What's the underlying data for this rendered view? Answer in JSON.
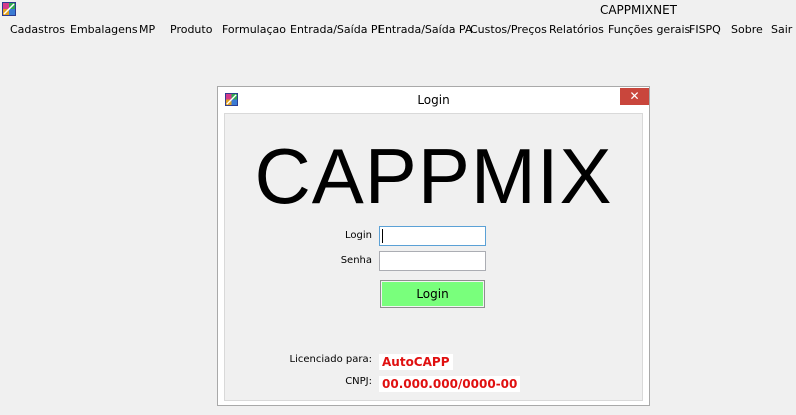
{
  "app": {
    "title": "CAPPMIXNET",
    "icon": "app-icon"
  },
  "menu": {
    "items": [
      "Cadastros",
      "Embalagens",
      "MP",
      "Produto",
      "Formulaçao",
      "Entrada/Saída PI",
      "Entrada/Saída PA",
      "Custos/Preços",
      "Relatórios",
      "Funções gerais",
      "FISPQ",
      "Sobre",
      "Sair"
    ]
  },
  "dialog": {
    "title": "Login",
    "close_label": "✕",
    "brand": "CAPPMIX",
    "login_label": "Login",
    "login_value": "",
    "password_label": "Senha",
    "password_value": "",
    "login_button": "Login",
    "licensed_label": "Licenciado para:",
    "licensed_value": "AutoCAPP",
    "cnpj_label": "CNPJ:",
    "cnpj_value": "00.000.000/0000-00"
  },
  "colors": {
    "background": "#f0f0f0",
    "close_button": "#c9463c",
    "login_button": "#79ff7c",
    "license_text": "#e01010"
  }
}
